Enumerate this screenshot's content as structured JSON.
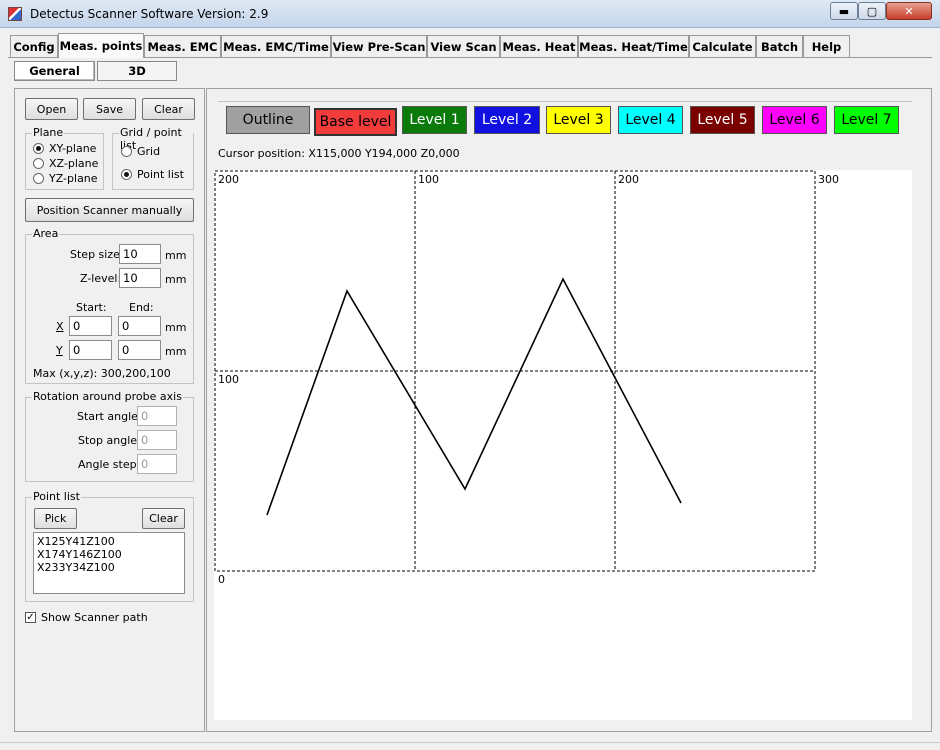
{
  "window": {
    "title": "Detectus Scanner Software Version: 2.9",
    "min_label": "▬",
    "max_label": "▢",
    "close_label": "✕"
  },
  "tabs": [
    {
      "label": "Config"
    },
    {
      "label": "Meas. points"
    },
    {
      "label": "Meas. EMC"
    },
    {
      "label": "Meas. EMC/Time"
    },
    {
      "label": "View Pre-Scan"
    },
    {
      "label": "View Scan"
    },
    {
      "label": "Meas. Heat"
    },
    {
      "label": "Meas. Heat/Time"
    },
    {
      "label": "Calculate"
    },
    {
      "label": "Batch"
    },
    {
      "label": "Help"
    }
  ],
  "subtabs": [
    {
      "label": "General"
    },
    {
      "label": "3D"
    }
  ],
  "left": {
    "open": "Open",
    "save": "Save",
    "clear": "Clear",
    "plane": {
      "title": "Plane",
      "options": [
        "XY-plane",
        "XZ-plane",
        "YZ-plane"
      ],
      "selected": "XY-plane"
    },
    "grid": {
      "title": "Grid / point list",
      "options": [
        "Grid",
        "Point list"
      ],
      "selected": "Point list"
    },
    "position_btn": "Position Scanner manually",
    "area": {
      "title": "Area",
      "step_label": "Step size:",
      "step_value": "10",
      "step_unit": "mm",
      "z_label": "Z-level:",
      "z_value": "10",
      "z_unit": "mm",
      "start_label": "Start:",
      "end_label": "End:",
      "x_label": "X",
      "x_start": "0",
      "x_end": "0",
      "x_unit": "mm",
      "y_label": "Y",
      "y_start": "0",
      "y_end": "0",
      "y_unit": "mm",
      "max_text": "Max (x,y,z): 300,200,100"
    },
    "rotation": {
      "title": "Rotation around probe axis",
      "start_label": "Start angle:",
      "start_value": "0",
      "stop_label": "Stop angle:",
      "stop_value": "0",
      "step_label": "Angle step:",
      "step_value": "0"
    },
    "pointlist": {
      "title": "Point list",
      "pick": "Pick",
      "clear": "Clear",
      "items": [
        "X125Y41Z100",
        "X174Y146Z100",
        "X233Y34Z100"
      ]
    },
    "show_path": {
      "label": "Show Scanner path",
      "checked": true
    }
  },
  "levels": [
    {
      "label": "Outline",
      "bg": "#a0a0a0",
      "fg": "#000000"
    },
    {
      "label": "Base level",
      "bg": "#f23c3c",
      "fg": "#000000"
    },
    {
      "label": "Level 1",
      "bg": "#0a7a0a",
      "fg": "#ffffff"
    },
    {
      "label": "Level 2",
      "bg": "#1010e0",
      "fg": "#ffffff"
    },
    {
      "label": "Level 3",
      "bg": "#ffff00",
      "fg": "#000000"
    },
    {
      "label": "Level 4",
      "bg": "#00ffff",
      "fg": "#000000"
    },
    {
      "label": "Level 5",
      "bg": "#7a0000",
      "fg": "#ffffff"
    },
    {
      "label": "Level 6",
      "bg": "#ff00ff",
      "fg": "#000000"
    },
    {
      "label": "Level 7",
      "bg": "#00ff00",
      "fg": "#000000"
    }
  ],
  "cursor_position": "Cursor position: X115,000 Y194,000 Z0,000",
  "plot": {
    "x_range": [
      0,
      300
    ],
    "y_range": [
      0,
      200
    ],
    "labels": [
      {
        "text": "200",
        "x": 0,
        "y": 200
      },
      {
        "text": "100",
        "x": 100,
        "y": 200
      },
      {
        "text": "200",
        "x": 200,
        "y": 200
      },
      {
        "text": "300",
        "x": 300,
        "y": 200
      },
      {
        "text": "100",
        "x": 0,
        "y": 100
      },
      {
        "text": "0",
        "x": 0,
        "y": 0
      }
    ],
    "path": [
      [
        26,
        28
      ],
      [
        66,
        140
      ],
      [
        125,
        41
      ],
      [
        174,
        146
      ],
      [
        233,
        34
      ]
    ]
  }
}
